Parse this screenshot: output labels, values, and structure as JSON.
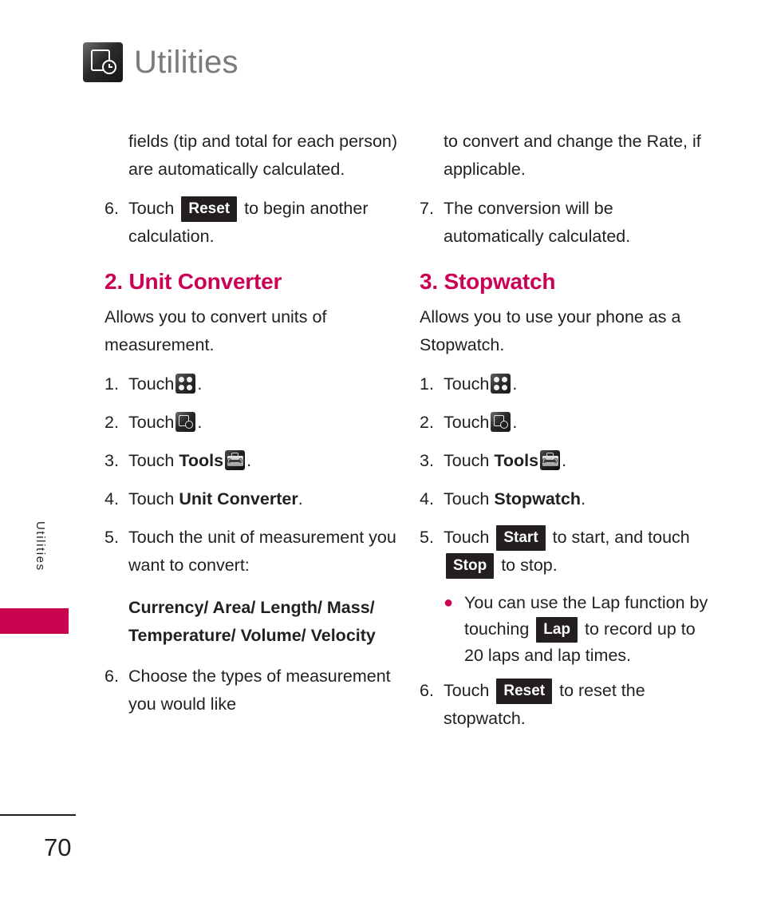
{
  "header": {
    "title": "Utilities",
    "icon": "utilities-clock-icon"
  },
  "side_tab": {
    "label": "Utilities",
    "color": "#c9054f"
  },
  "footer": {
    "page_number": "70"
  },
  "colors": {
    "heading": "#cc0055",
    "bullet": "#cc0055",
    "key_chip_bg": "#231f20",
    "header_title": "#7b7b7b"
  },
  "left_column": {
    "continuation": {
      "line1": "fields (tip and total for each",
      "line2": "person) are automatically",
      "line3": "calculated."
    },
    "step6": {
      "num": "6.",
      "before": "Touch",
      "key": "Reset",
      "after": "to begin another calculation."
    },
    "section": {
      "heading": "2. Unit Converter",
      "intro": "Allows you to convert units of measurement.",
      "steps": [
        {
          "num": "1.",
          "before": "Touch",
          "icon": "grid-menu-icon",
          "after": "."
        },
        {
          "num": "2.",
          "before": "Touch",
          "icon": "utilities-clock-icon",
          "after": "."
        },
        {
          "num": "3.",
          "before": "Touch",
          "bold": "Tools",
          "icon": "tools-briefcase-icon",
          "after": "."
        },
        {
          "num": "4.",
          "before": "Touch",
          "bold": "Unit Converter",
          "after": "."
        },
        {
          "num": "5.",
          "text": "Touch the unit of measurement you want to convert:"
        }
      ],
      "units": "Currency/ Area/ Length/ Mass/ Temperature/ Volume/ Velocity",
      "step6": {
        "num": "6.",
        "text": "Choose the types of measurement you would like"
      }
    }
  },
  "right_column": {
    "continuation": {
      "line1": "to convert and change the",
      "line2": "Rate, if applicable."
    },
    "step7": {
      "num": "7.",
      "text": "The conversion will be automatically calculated."
    },
    "section": {
      "heading": "3. Stopwatch",
      "intro": "Allows you to use your phone as a Stopwatch.",
      "steps": [
        {
          "num": "1.",
          "before": "Touch",
          "icon": "grid-menu-icon",
          "after": "."
        },
        {
          "num": "2.",
          "before": "Touch",
          "icon": "utilities-clock-icon",
          "after": "."
        },
        {
          "num": "3.",
          "before": "Touch",
          "bold": "Tools",
          "icon": "tools-briefcase-icon",
          "after": "."
        },
        {
          "num": "4.",
          "before": "Touch",
          "bold": "Stopwatch",
          "after": "."
        }
      ],
      "step5": {
        "num": "5.",
        "before": "Touch",
        "key_start": "Start",
        "middle": "to start, and touch",
        "key_stop": "Stop",
        "after": "to stop."
      },
      "bullet": {
        "marker": "●",
        "before": "You can use the Lap function by touching",
        "key": "Lap",
        "after": "to record up to 20 laps and lap times."
      },
      "step6": {
        "num": "6.",
        "before": "Touch",
        "key": "Reset",
        "after": "to reset the stopwatch."
      }
    }
  }
}
